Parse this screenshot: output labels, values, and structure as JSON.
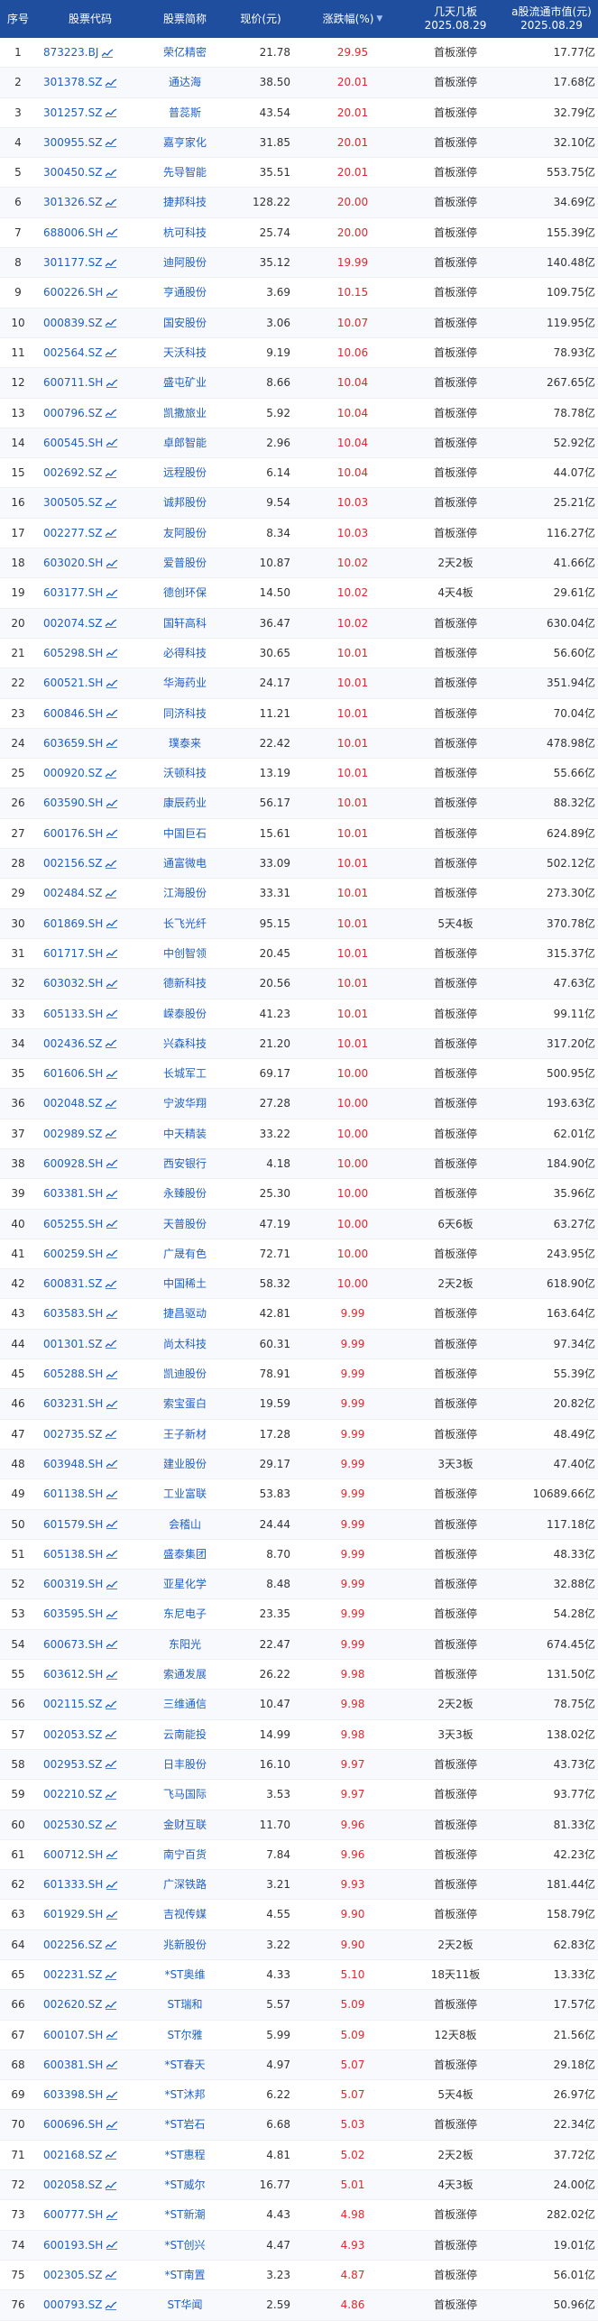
{
  "headers": {
    "index": "序号",
    "code": "股票代码",
    "name": "股票简称",
    "price": "现价(元)",
    "change": "涨跌幅(%)",
    "board_line1": "几天几板",
    "board_line2": "2025.08.29",
    "cap_line1": "a股流通市值(元)",
    "cap_line2": "2025.08.29",
    "sort_icon": "sort-desc-icon"
  },
  "colors": {
    "header_bg": "#1f4e9e",
    "link": "#2160c4",
    "up": "#e0282e"
  },
  "rows": [
    [
      "1",
      "873223.BJ",
      "荣亿精密",
      "21.78",
      "29.95",
      "首板涨停",
      "17.77亿"
    ],
    [
      "2",
      "301378.SZ",
      "通达海",
      "38.50",
      "20.01",
      "首板涨停",
      "17.68亿"
    ],
    [
      "3",
      "301257.SZ",
      "普蕊斯",
      "43.54",
      "20.01",
      "首板涨停",
      "32.79亿"
    ],
    [
      "4",
      "300955.SZ",
      "嘉亨家化",
      "31.85",
      "20.01",
      "首板涨停",
      "32.10亿"
    ],
    [
      "5",
      "300450.SZ",
      "先导智能",
      "35.51",
      "20.01",
      "首板涨停",
      "553.75亿"
    ],
    [
      "6",
      "301326.SZ",
      "捷邦科技",
      "128.22",
      "20.00",
      "首板涨停",
      "34.69亿"
    ],
    [
      "7",
      "688006.SH",
      "杭可科技",
      "25.74",
      "20.00",
      "首板涨停",
      "155.39亿"
    ],
    [
      "8",
      "301177.SZ",
      "迪阿股份",
      "35.12",
      "19.99",
      "首板涨停",
      "140.48亿"
    ],
    [
      "9",
      "600226.SH",
      "亨通股份",
      "3.69",
      "10.15",
      "首板涨停",
      "109.75亿"
    ],
    [
      "10",
      "000839.SZ",
      "国安股份",
      "3.06",
      "10.07",
      "首板涨停",
      "119.95亿"
    ],
    [
      "11",
      "002564.SZ",
      "天沃科技",
      "9.19",
      "10.06",
      "首板涨停",
      "78.93亿"
    ],
    [
      "12",
      "600711.SH",
      "盛屯矿业",
      "8.66",
      "10.04",
      "首板涨停",
      "267.65亿"
    ],
    [
      "13",
      "000796.SZ",
      "凯撒旅业",
      "5.92",
      "10.04",
      "首板涨停",
      "78.78亿"
    ],
    [
      "14",
      "600545.SH",
      "卓郎智能",
      "2.96",
      "10.04",
      "首板涨停",
      "52.92亿"
    ],
    [
      "15",
      "002692.SZ",
      "远程股份",
      "6.14",
      "10.04",
      "首板涨停",
      "44.07亿"
    ],
    [
      "16",
      "300505.SZ",
      "诚邦股份",
      "9.54",
      "10.03",
      "首板涨停",
      "25.21亿"
    ],
    [
      "17",
      "002277.SZ",
      "友阿股份",
      "8.34",
      "10.03",
      "首板涨停",
      "116.27亿"
    ],
    [
      "18",
      "603020.SH",
      "爱普股份",
      "10.87",
      "10.02",
      "2天2板",
      "41.66亿"
    ],
    [
      "19",
      "603177.SH",
      "德创环保",
      "14.50",
      "10.02",
      "4天4板",
      "29.61亿"
    ],
    [
      "20",
      "002074.SZ",
      "国轩高科",
      "36.47",
      "10.02",
      "首板涨停",
      "630.04亿"
    ],
    [
      "21",
      "605298.SH",
      "必得科技",
      "30.65",
      "10.01",
      "首板涨停",
      "56.60亿"
    ],
    [
      "22",
      "600521.SH",
      "华海药业",
      "24.17",
      "10.01",
      "首板涨停",
      "351.94亿"
    ],
    [
      "23",
      "600846.SH",
      "同济科技",
      "11.21",
      "10.01",
      "首板涨停",
      "70.04亿"
    ],
    [
      "24",
      "603659.SH",
      "璞泰来",
      "22.42",
      "10.01",
      "首板涨停",
      "478.98亿"
    ],
    [
      "25",
      "000920.SZ",
      "沃顿科技",
      "13.19",
      "10.01",
      "首板涨停",
      "55.66亿"
    ],
    [
      "26",
      "603590.SH",
      "康辰药业",
      "56.17",
      "10.01",
      "首板涨停",
      "88.32亿"
    ],
    [
      "27",
      "600176.SH",
      "中国巨石",
      "15.61",
      "10.01",
      "首板涨停",
      "624.89亿"
    ],
    [
      "28",
      "002156.SZ",
      "通富微电",
      "33.09",
      "10.01",
      "首板涨停",
      "502.12亿"
    ],
    [
      "29",
      "002484.SZ",
      "江海股份",
      "33.31",
      "10.01",
      "首板涨停",
      "273.30亿"
    ],
    [
      "30",
      "601869.SH",
      "长飞光纤",
      "95.15",
      "10.01",
      "5天4板",
      "370.78亿"
    ],
    [
      "31",
      "601717.SH",
      "中创智领",
      "20.45",
      "10.01",
      "首板涨停",
      "315.37亿"
    ],
    [
      "32",
      "603032.SH",
      "德新科技",
      "20.56",
      "10.01",
      "首板涨停",
      "47.63亿"
    ],
    [
      "33",
      "605133.SH",
      "嵘泰股份",
      "41.23",
      "10.01",
      "首板涨停",
      "99.11亿"
    ],
    [
      "34",
      "002436.SZ",
      "兴森科技",
      "21.20",
      "10.01",
      "首板涨停",
      "317.20亿"
    ],
    [
      "35",
      "601606.SH",
      "长城军工",
      "69.17",
      "10.00",
      "首板涨停",
      "500.95亿"
    ],
    [
      "36",
      "002048.SZ",
      "宁波华翔",
      "27.28",
      "10.00",
      "首板涨停",
      "193.63亿"
    ],
    [
      "37",
      "002989.SZ",
      "中天精装",
      "33.22",
      "10.00",
      "首板涨停",
      "62.01亿"
    ],
    [
      "38",
      "600928.SH",
      "西安银行",
      "4.18",
      "10.00",
      "首板涨停",
      "184.90亿"
    ],
    [
      "39",
      "603381.SH",
      "永臻股份",
      "25.30",
      "10.00",
      "首板涨停",
      "35.96亿"
    ],
    [
      "40",
      "605255.SH",
      "天普股份",
      "47.19",
      "10.00",
      "6天6板",
      "63.27亿"
    ],
    [
      "41",
      "600259.SH",
      "广晟有色",
      "72.71",
      "10.00",
      "首板涨停",
      "243.95亿"
    ],
    [
      "42",
      "600831.SZ",
      "中国稀土",
      "58.32",
      "10.00",
      "2天2板",
      "618.90亿"
    ],
    [
      "43",
      "603583.SH",
      "捷昌驱动",
      "42.81",
      "9.99",
      "首板涨停",
      "163.64亿"
    ],
    [
      "44",
      "001301.SZ",
      "尚太科技",
      "60.31",
      "9.99",
      "首板涨停",
      "97.34亿"
    ],
    [
      "45",
      "605288.SH",
      "凯迪股份",
      "78.91",
      "9.99",
      "首板涨停",
      "55.39亿"
    ],
    [
      "46",
      "603231.SH",
      "索宝蛋白",
      "19.59",
      "9.99",
      "首板涨停",
      "20.82亿"
    ],
    [
      "47",
      "002735.SZ",
      "王子新材",
      "17.28",
      "9.99",
      "首板涨停",
      "48.49亿"
    ],
    [
      "48",
      "603948.SH",
      "建业股份",
      "29.17",
      "9.99",
      "3天3板",
      "47.40亿"
    ],
    [
      "49",
      "601138.SH",
      "工业富联",
      "53.83",
      "9.99",
      "首板涨停",
      "10689.66亿"
    ],
    [
      "50",
      "601579.SH",
      "会稽山",
      "24.44",
      "9.99",
      "首板涨停",
      "117.18亿"
    ],
    [
      "51",
      "605138.SH",
      "盛泰集团",
      "8.70",
      "9.99",
      "首板涨停",
      "48.33亿"
    ],
    [
      "52",
      "600319.SH",
      "亚星化学",
      "8.48",
      "9.99",
      "首板涨停",
      "32.88亿"
    ],
    [
      "53",
      "603595.SH",
      "东尼电子",
      "23.35",
      "9.99",
      "首板涨停",
      "54.28亿"
    ],
    [
      "54",
      "600673.SH",
      "东阳光",
      "22.47",
      "9.99",
      "首板涨停",
      "674.45亿"
    ],
    [
      "55",
      "603612.SH",
      "索通发展",
      "26.22",
      "9.98",
      "首板涨停",
      "131.50亿"
    ],
    [
      "56",
      "002115.SZ",
      "三维通信",
      "10.47",
      "9.98",
      "2天2板",
      "78.75亿"
    ],
    [
      "57",
      "002053.SZ",
      "云南能投",
      "14.99",
      "9.98",
      "3天3板",
      "138.02亿"
    ],
    [
      "58",
      "002953.SZ",
      "日丰股份",
      "16.10",
      "9.97",
      "首板涨停",
      "43.73亿"
    ],
    [
      "59",
      "002210.SZ",
      "飞马国际",
      "3.53",
      "9.97",
      "首板涨停",
      "93.77亿"
    ],
    [
      "60",
      "002530.SZ",
      "金财互联",
      "11.70",
      "9.96",
      "首板涨停",
      "81.33亿"
    ],
    [
      "61",
      "600712.SH",
      "南宁百货",
      "7.84",
      "9.96",
      "首板涨停",
      "42.23亿"
    ],
    [
      "62",
      "601333.SH",
      "广深铁路",
      "3.21",
      "9.93",
      "首板涨停",
      "181.44亿"
    ],
    [
      "63",
      "601929.SH",
      "吉视传媒",
      "4.55",
      "9.90",
      "首板涨停",
      "158.79亿"
    ],
    [
      "64",
      "002256.SZ",
      "兆新股份",
      "3.22",
      "9.90",
      "2天2板",
      "62.83亿"
    ],
    [
      "65",
      "002231.SZ",
      "*ST奥维",
      "4.33",
      "5.10",
      "18天11板",
      "13.33亿"
    ],
    [
      "66",
      "002620.SZ",
      "ST瑞和",
      "5.57",
      "5.09",
      "首板涨停",
      "17.57亿"
    ],
    [
      "67",
      "600107.SH",
      "ST尔雅",
      "5.99",
      "5.09",
      "12天8板",
      "21.56亿"
    ],
    [
      "68",
      "600381.SH",
      "*ST春天",
      "4.97",
      "5.07",
      "首板涨停",
      "29.18亿"
    ],
    [
      "69",
      "603398.SH",
      "*ST沐邦",
      "6.22",
      "5.07",
      "5天4板",
      "26.97亿"
    ],
    [
      "70",
      "600696.SH",
      "*ST岩石",
      "6.68",
      "5.03",
      "首板涨停",
      "22.34亿"
    ],
    [
      "71",
      "002168.SZ",
      "*ST惠程",
      "4.81",
      "5.02",
      "2天2板",
      "37.72亿"
    ],
    [
      "72",
      "002058.SZ",
      "*ST威尔",
      "16.77",
      "5.01",
      "4天3板",
      "24.00亿"
    ],
    [
      "73",
      "600777.SH",
      "*ST新潮",
      "4.43",
      "4.98",
      "首板涨停",
      "282.02亿"
    ],
    [
      "74",
      "600193.SH",
      "*ST创兴",
      "4.47",
      "4.93",
      "首板涨停",
      "19.01亿"
    ],
    [
      "75",
      "002305.SZ",
      "*ST南置",
      "3.23",
      "4.87",
      "首板涨停",
      "56.01亿"
    ],
    [
      "76",
      "000793.SZ",
      "ST华闻",
      "2.59",
      "4.86",
      "首板涨停",
      "50.96亿"
    ]
  ]
}
